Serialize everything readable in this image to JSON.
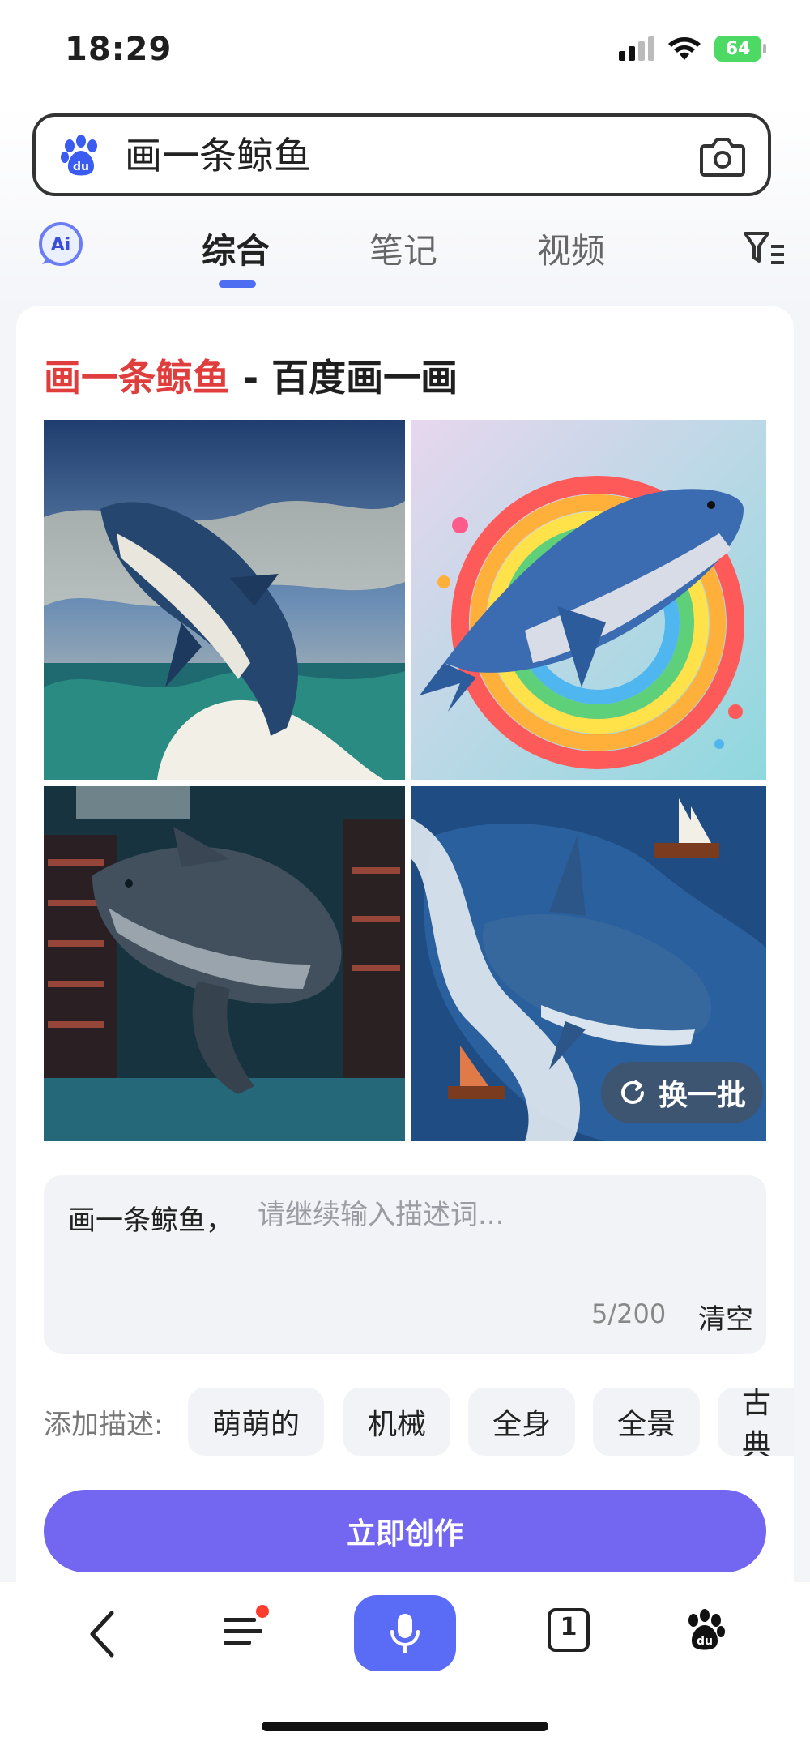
{
  "status": {
    "time": "18:29",
    "battery": "64"
  },
  "search": {
    "query": "画一条鲸鱼"
  },
  "tabs": [
    {
      "label": "综合",
      "active": true
    },
    {
      "label": "笔记",
      "active": false
    },
    {
      "label": "视频",
      "active": false
    }
  ],
  "card": {
    "title_highlight": "画一条鲸鱼",
    "title_rest": " - 百度画一画",
    "regenerate_label": "换一批",
    "prompt_prefix": "画一条鲸鱼，",
    "prompt_placeholder": "请继续输入描述词...",
    "char_count": "5/200",
    "clear_label": "清空",
    "add_desc_label": "添加描述:",
    "chips": [
      "萌萌的",
      "机械",
      "全身",
      "全景",
      "古典"
    ],
    "create_label": "立即创作"
  },
  "bottom_nav": {
    "tab_count": "1"
  },
  "colors": {
    "accent": "#4e6ef2",
    "create": "#7366f0",
    "highlight": "#e03d3d",
    "mic": "#5a6cf6"
  },
  "icons": [
    "baidu-paw-icon",
    "camera-icon",
    "ai-badge-icon",
    "filter-icon",
    "refresh-icon",
    "back-icon",
    "menu-icon",
    "mic-icon",
    "tabs-icon"
  ]
}
